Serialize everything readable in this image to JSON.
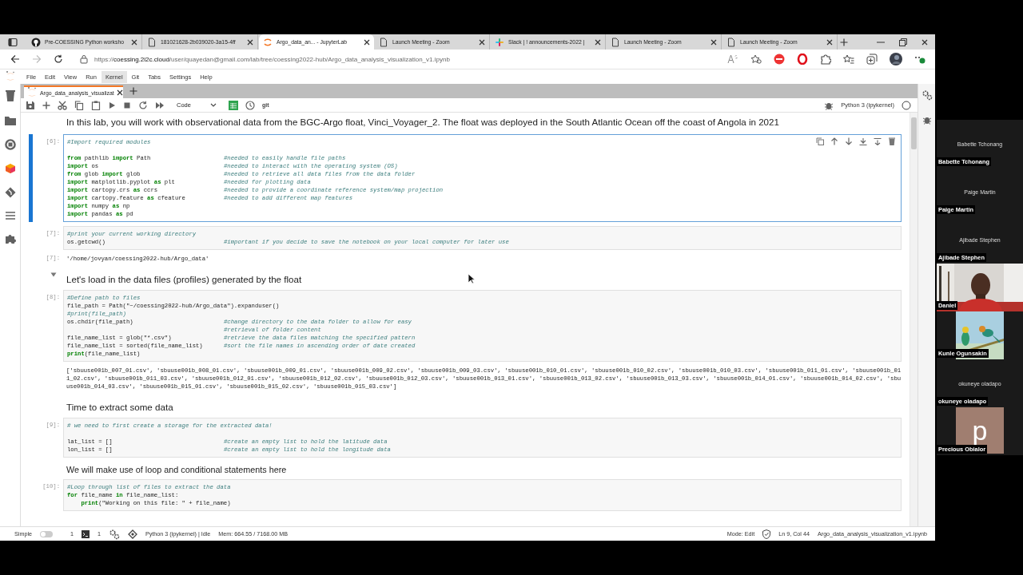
{
  "browser": {
    "tabs": [
      {
        "title": "Pre-COESSING Python worksho",
        "kind": "repo",
        "selected": false
      },
      {
        "title": "181021628-2b039020-3a15-4ff",
        "kind": "file",
        "selected": false
      },
      {
        "title": "Argo_data_an... - JupyterLab",
        "kind": "notebook",
        "selected": true
      },
      {
        "title": "Launch Meeting - Zoom",
        "kind": "file",
        "selected": false
      },
      {
        "title": "Slack | ! announcements-2022 |",
        "kind": "chat",
        "selected": false
      },
      {
        "title": "Launch Meeting - Zoom",
        "kind": "file",
        "selected": false
      },
      {
        "title": "Launch Meeting - Zoom",
        "kind": "file",
        "selected": false
      }
    ],
    "url": "https://**coessing.2i2c.cloud**/user/quayedan@gmail.com/lab/tree/coessing2022-hub/Argo_data_analysis_visualization_v1.ipynb"
  },
  "jupyterlab": {
    "menu": [
      {
        "label": "File",
        "selected": false
      },
      {
        "label": "Edit",
        "selected": false
      },
      {
        "label": "View",
        "selected": false
      },
      {
        "label": "Run",
        "selected": false
      },
      {
        "label": "Kernel",
        "selected": true
      },
      {
        "label": "Git",
        "selected": false
      },
      {
        "label": "Tabs",
        "selected": false
      },
      {
        "label": "Settings",
        "selected": false
      },
      {
        "label": "Help",
        "selected": false
      }
    ],
    "document_tab": {
      "title": "Argo_data_analysis_visualizat"
    },
    "toolbar": {
      "cell_type": "Code",
      "git": "git",
      "kernel": "Python 3 (ipykernel)",
      "kernel_busy": false
    },
    "cells": [
      {
        "kind": "intro",
        "text": "In this lab, you will work with observational data from the BGC-Argo float, Vinci_Voyager_2. The float was deployed in the South Atlantic Ocean off the coast of Angola in 2021"
      },
      {
        "kind": "code",
        "prompt": "[6]:",
        "selected": true,
        "blocks": [
          [
            {
              "kind": "note",
              "comment": "#Import required modules"
            }
          ],
          [
            {
              "kind": "code",
              "code": "**from** pathlib **import** Path",
              "comment": "#needed to easily handle file paths"
            },
            {
              "kind": "code",
              "code": "**import** os",
              "comment": "#needed to interact with the operating system (OS)"
            },
            {
              "kind": "code",
              "code": "**from** glob **import** glob",
              "comment": "#needed to retrieve all data files from the data folder"
            },
            {
              "kind": "code",
              "code": "**import** matplotlib.pyplot **as** plt",
              "comment": "#needed for plotting data"
            },
            {
              "kind": "code",
              "code": "**import** cartopy.crs **as** ccrs",
              "comment": "#needed to provide a coordinate reference system/map projection"
            },
            {
              "kind": "code",
              "code": "**import** cartopy.feature **as** cfeature",
              "comment": "#needed to add different map features"
            },
            {
              "kind": "code",
              "code": "**import** numpy **as** np"
            },
            {
              "kind": "code",
              "code": "**import** pandas **as** pd"
            }
          ]
        ]
      },
      {
        "kind": "code",
        "prompt": "[7]:",
        "selected": false,
        "blocks": [
          [
            {
              "kind": "note",
              "comment": "#print your current working directory"
            },
            {
              "kind": "code",
              "code": "os.getcwd()",
              "comment": "#important if you decide to save the notebook on your local computer for later use"
            }
          ]
        ],
        "output": {
          "prompt": "[7]:",
          "text": "'/home/jovyan/coessing2022-hub/Argo_data'"
        }
      },
      {
        "kind": "heading",
        "text": "Let's load in the data files (profiles) generated by the float",
        "expanded": true
      },
      {
        "kind": "code",
        "prompt": "[8]:",
        "selected": false,
        "blocks": [
          [
            {
              "kind": "note",
              "comment": "#Define path to files"
            },
            {
              "kind": "code",
              "code": "file_path = Path(\"~/coessing2022-hub/Argo_data\").expanduser()"
            },
            {
              "kind": "note",
              "comment": "#print(file_path)"
            },
            {
              "kind": "code",
              "code": "os.chdir(file_path)",
              "comment": "#change directory to the data folder to allow for easy"
            },
            {
              "kind": "cont",
              "comment": "#retrieval of folder content"
            },
            {
              "kind": "code",
              "code": "file_name_list = glob(\"*.csv\")",
              "comment": "#retrieve the data files matching the specified pattern"
            },
            {
              "kind": "code",
              "code": "file_name_list = sorted(file_name_list)",
              "comment": "#sort the file names in ascending order of date created"
            },
            {
              "kind": "code",
              "code": "**print**(file_name_list)"
            }
          ]
        ],
        "output": {
          "text": "['sbuuse001b_007_01.csv', 'sbuuse001b_008_01.csv', 'sbuuse001b_009_01.csv', 'sbuuse001b_009_02.csv', 'sbuuse001b_009_03.csv', 'sbuuse001b_010_01.csv', 'sbuuse001b_010_02.csv', 'sbuuse001b_010_03.csv', 'sbuuse001b_011_01.csv', 'sbuuse001b_011_02.csv', 'sbuuse001b_011_03.csv', 'sbuuse001b_012_01.csv', 'sbuuse001b_012_02.csv', 'sbuuse001b_012_03.csv', 'sbuuse001b_013_01.csv', 'sbuuse001b_013_02.csv', 'sbuuse001b_013_03.csv', 'sbuuse001b_014_01.csv', 'sbuuse001b_014_02.csv', 'sbuuse001b_014_03.csv', 'sbuuse001b_015_01.csv', 'sbuuse001b_015_02.csv', 'sbuuse001b_015_03.csv']"
        }
      },
      {
        "kind": "heading",
        "text": "Time to extract some data"
      },
      {
        "kind": "code",
        "prompt": "[9]:",
        "selected": false,
        "blocks": [
          [
            {
              "kind": "note",
              "comment": "# we need to first create a storage for the extracted data!"
            }
          ],
          [
            {
              "kind": "code",
              "code": "lat_list = []",
              "comment": "#create an empty list to hold the latitude data"
            },
            {
              "kind": "code",
              "code": "lon_list = []",
              "comment": "#create an empty list to hold the longitude data"
            }
          ]
        ]
      },
      {
        "kind": "paragraph",
        "text": "We will make use of loop and conditional statements here"
      },
      {
        "kind": "code",
        "prompt": "[10]:",
        "selected": false,
        "blocks": [
          [
            {
              "kind": "note",
              "comment": "#Loop through list of files to extract the data"
            },
            {
              "kind": "code",
              "code": "**for** file_name **in** file_name_list:"
            },
            {
              "kind": "code",
              "code": "    **print**(\"Working on this file: \" + file_name)"
            }
          ]
        ]
      }
    ],
    "status_bar": {
      "simple_label": "Simple",
      "simple_mode": false,
      "terminals": "1",
      "kernels": "1",
      "kernel_status": "Python 3 (ipykernel) | Idle",
      "memory": "Mem: 664.55 / 7168.00 MB",
      "mode": "Mode: Edit",
      "cursor": "Ln 9, Col 44",
      "file": "Argo_data_analysis_visualization_v1.ipynb"
    }
  },
  "meeting": {
    "participants": [
      {
        "kind": "name",
        "display_name": "Babette Tchonang",
        "label": "Babette Tchonang"
      },
      {
        "kind": "name",
        "display_name": "Paige Martin",
        "label": "Paige Martin"
      },
      {
        "kind": "name",
        "display_name": "Ajibade Stephen",
        "label": "Ajibade Stephen"
      },
      {
        "kind": "video",
        "label": "Daniel"
      },
      {
        "label": "Kunle Ogunsakin"
      },
      {
        "kind": "name",
        "display_name": "okuneye oladapo",
        "label": "okuneye oladapo"
      },
      {
        "kind": "initial",
        "initial": "p",
        "label": "Precious Obialor"
      }
    ]
  }
}
